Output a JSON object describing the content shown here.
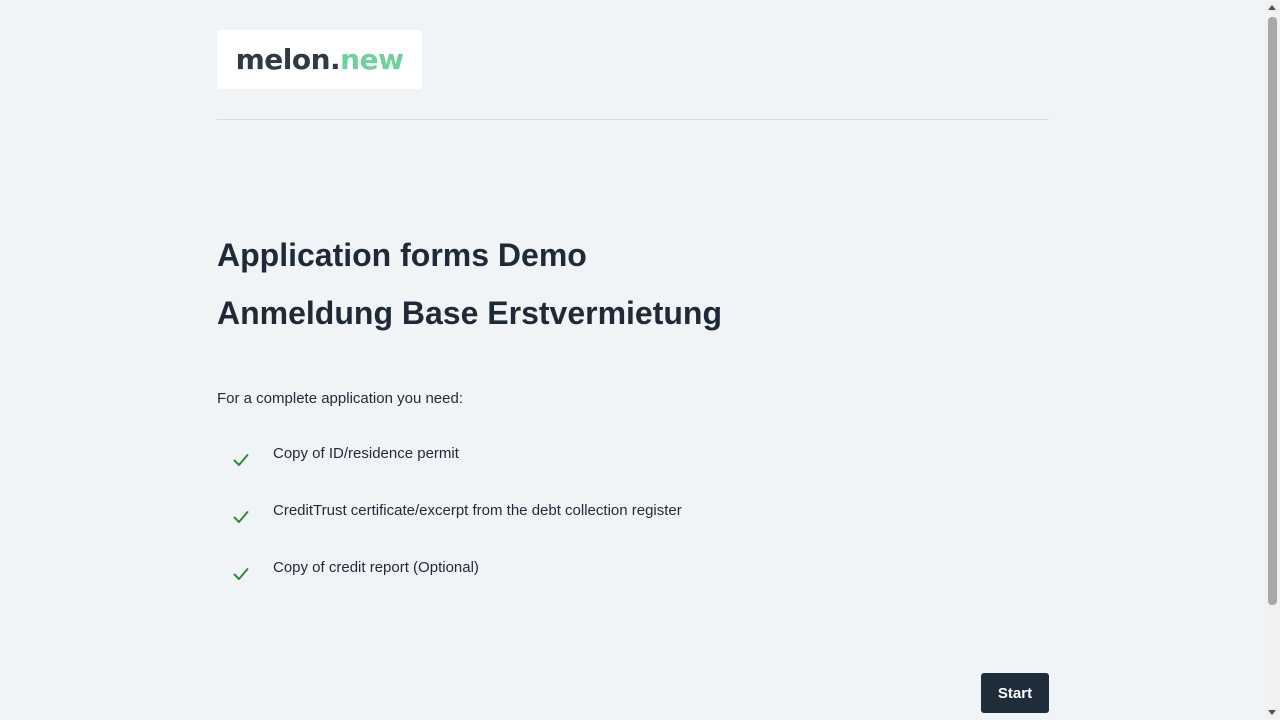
{
  "logo": {
    "main": "melon.",
    "accent": "new"
  },
  "titles": {
    "line1": "Application forms Demo",
    "line2": "Anmeldung Base Erstvermietung"
  },
  "intro": "For a complete application you need:",
  "requirements": [
    {
      "label": "Copy of ID/residence permit",
      "icon": "check-icon"
    },
    {
      "label": "CreditTrust certificate/excerpt from the debt collection register",
      "icon": "check-icon"
    },
    {
      "label": "Copy of credit report (Optional)",
      "icon": "check-icon"
    }
  ],
  "actions": {
    "start_label": "Start"
  },
  "colors": {
    "background": "#f1f4f7",
    "text": "#1e2a38",
    "brand_accent": "#6ed39b",
    "check": "#2e8b3a",
    "button": "#1f2d3a"
  }
}
